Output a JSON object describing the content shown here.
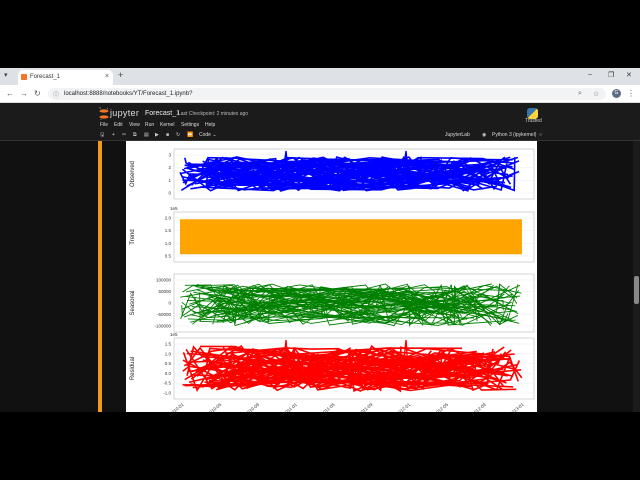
{
  "browser": {
    "tab_title": "Forecast_1",
    "tab_close": "×",
    "new_tab": "+",
    "url": "localhost:8888/notebooks/YT/Forecast_1.ipynb?",
    "profile_initial": "G",
    "window_controls": [
      "⌄",
      "–",
      "❐",
      "✕"
    ]
  },
  "jupyter": {
    "brand": "jupyter",
    "notebook_title": "Forecast_1",
    "checkpoint": "Last Checkpoint: 2 minutes ago",
    "trusted": "Trusted",
    "menus": [
      "File",
      "Edit",
      "View",
      "Run",
      "Kernel",
      "Settings",
      "Help"
    ],
    "cell_type": "Code",
    "jupyterlab_link": "JupyterLab",
    "kernel_name": "Python 3 (ipykernel)"
  },
  "chart_data": [
    {
      "type": "line",
      "ylabel": "Observed",
      "yticks": [
        "3",
        "2",
        "1",
        "0"
      ],
      "color": "#0000ff",
      "style": "dense zig-zag lines filling band; sharp spikes near 2011 and 2012"
    },
    {
      "type": "line",
      "ylabel": "Trend",
      "scale_label": "1e5",
      "yticks": [
        "2.0",
        "1.5",
        "1.0",
        "0.5"
      ],
      "color": "#ffa500",
      "style": "dense horizontal lines filling band"
    },
    {
      "type": "line",
      "ylabel": "Seasonal",
      "yticks": [
        "100000",
        "50000",
        "0",
        "-50000",
        "-100000"
      ],
      "color": "#008000",
      "style": "dense zig-zag seasonal pattern"
    },
    {
      "type": "line",
      "ylabel": "Residual",
      "scale_label": "1e5",
      "yticks": [
        "1.5",
        "1.0",
        "0.5",
        "0.0",
        "-0.5",
        "-1.0"
      ],
      "color": "#ff0000",
      "style": "dense zig-zag lines with spikes near 2011 and 2012",
      "xticks": [
        "2010-01",
        "2010-05",
        "2010-09",
        "2011-01",
        "2011-05",
        "2011-09",
        "2012-01",
        "2012-05",
        "2012-09",
        "2013-01"
      ]
    }
  ]
}
